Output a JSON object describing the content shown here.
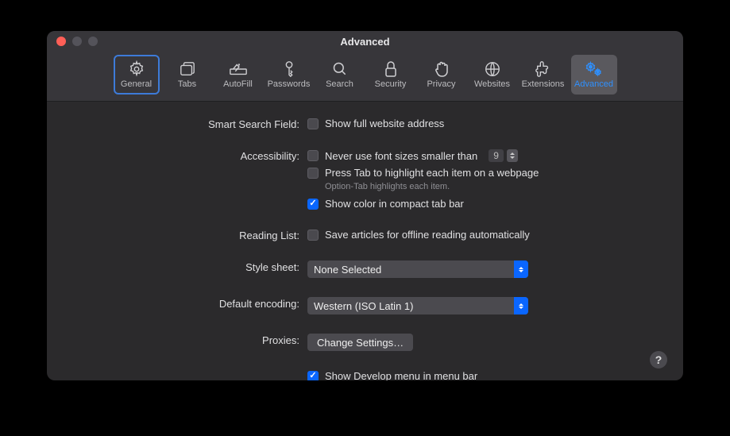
{
  "window": {
    "title": "Advanced"
  },
  "toolbar": {
    "items": [
      {
        "label": "General"
      },
      {
        "label": "Tabs"
      },
      {
        "label": "AutoFill"
      },
      {
        "label": "Passwords"
      },
      {
        "label": "Search"
      },
      {
        "label": "Security"
      },
      {
        "label": "Privacy"
      },
      {
        "label": "Websites"
      },
      {
        "label": "Extensions"
      },
      {
        "label": "Advanced"
      }
    ]
  },
  "sections": {
    "smartSearch": {
      "label": "Smart Search Field:",
      "showFullAddress": "Show full website address"
    },
    "accessibility": {
      "label": "Accessibility:",
      "neverUseFont": "Never use font sizes smaller than",
      "fontSizeValue": "9",
      "pressTab": "Press Tab to highlight each item on a webpage",
      "pressTabHint": "Option-Tab highlights each item.",
      "showColor": "Show color in compact tab bar"
    },
    "readingList": {
      "label": "Reading List:",
      "saveOffline": "Save articles for offline reading automatically"
    },
    "styleSheet": {
      "label": "Style sheet:",
      "value": "None Selected"
    },
    "defaultEncoding": {
      "label": "Default encoding:",
      "value": "Western (ISO Latin 1)"
    },
    "proxies": {
      "label": "Proxies:",
      "button": "Change Settings…"
    },
    "develop": {
      "label": "Show Develop menu in menu bar"
    }
  },
  "help": "?"
}
